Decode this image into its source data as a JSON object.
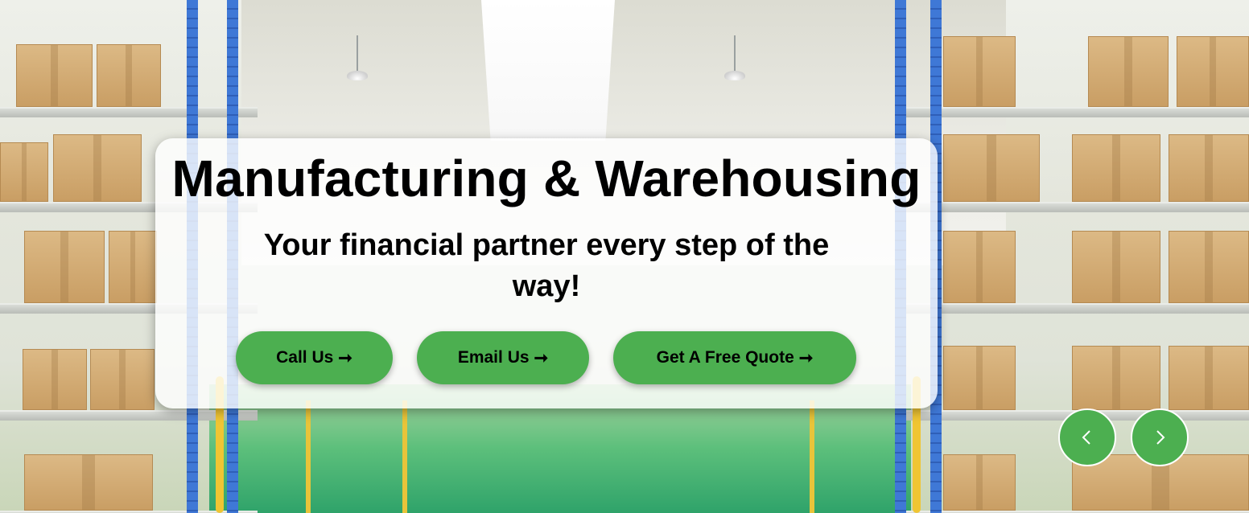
{
  "hero": {
    "title": "Manufacturing & Warehousing",
    "subtitle": "Your financial partner every step of the way!",
    "background_icon": "warehouse-shelves-image"
  },
  "buttons": {
    "call_label": "Call Us",
    "email_label": "Email Us",
    "quote_label": "Get A Free Quote",
    "arrow_glyph": "➞",
    "arrow_icon": "arrow-right-icon"
  },
  "carousel": {
    "prev_icon": "chevron-left-icon",
    "next_icon": "chevron-right-icon"
  },
  "colors": {
    "accent": "#4caf50",
    "card_background": "#ffffff",
    "text": "#000000"
  }
}
